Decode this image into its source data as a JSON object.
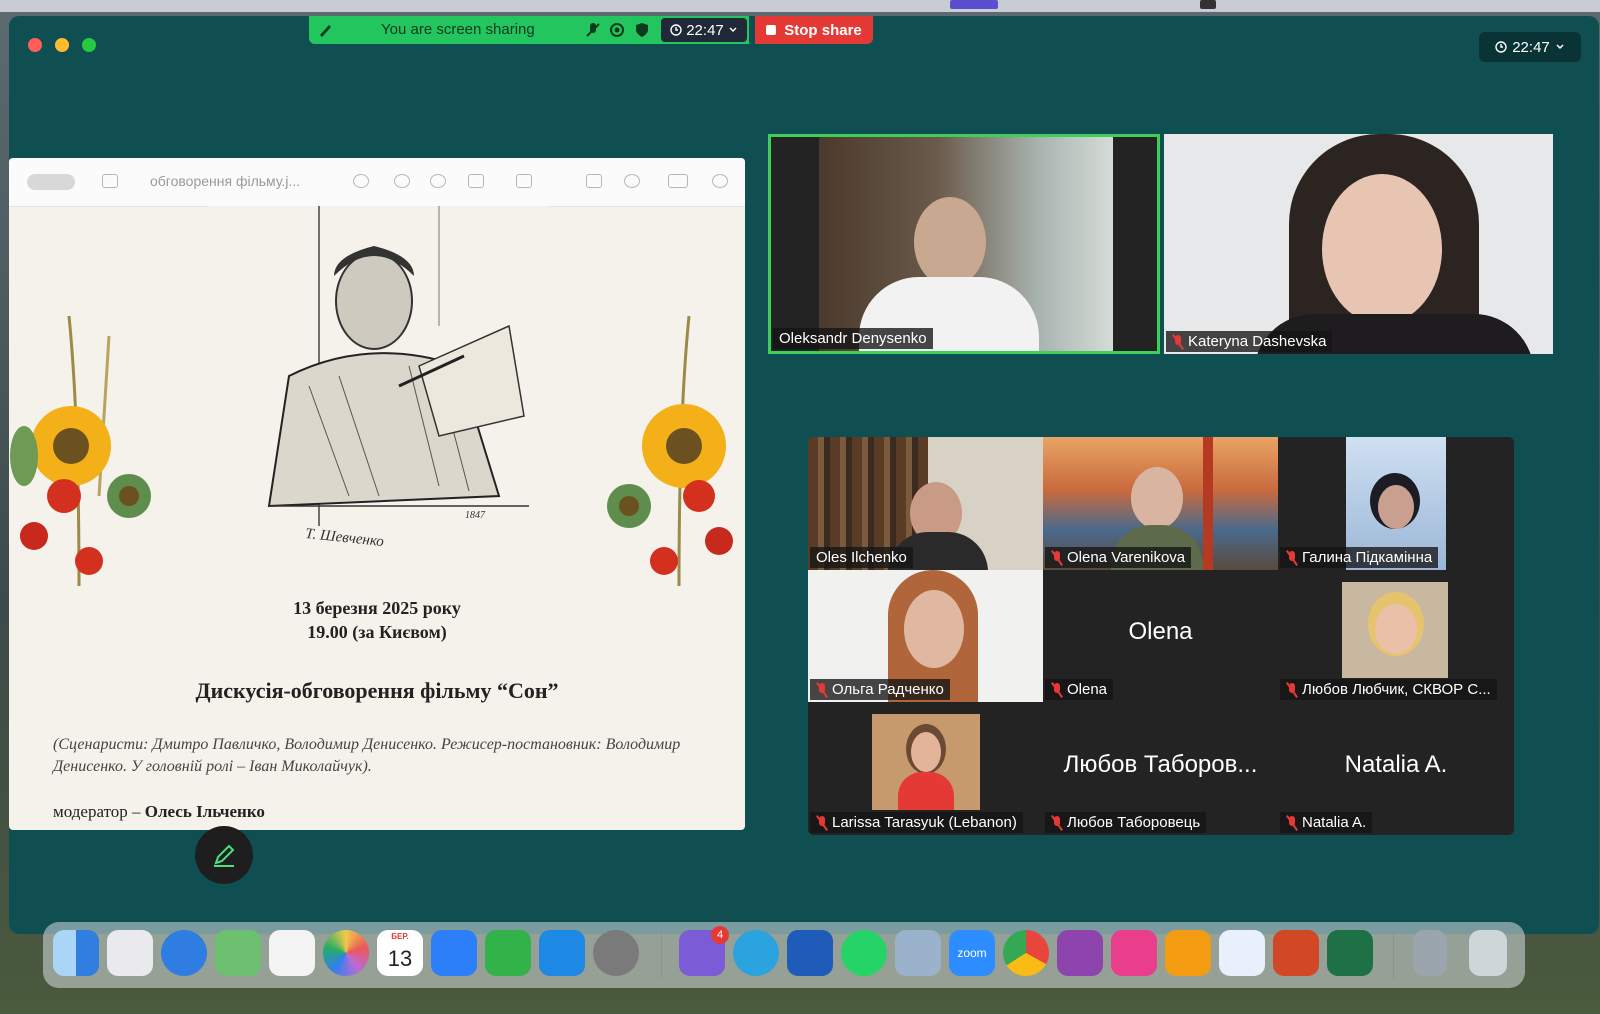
{
  "share_bar": {
    "status": "You are screen sharing",
    "time": "22:47",
    "stop_label": "Stop share",
    "color": "#22c55e"
  },
  "window": {
    "clock": "22:47",
    "bg": "#0f4f52"
  },
  "document": {
    "filename": "обговорення фільму.j...",
    "signature": "Т. Шевченко",
    "year": "1847",
    "date_line1": "13 березня 2025 року",
    "date_line2": "19.00 (за Києвом)",
    "heading": "Дискусія-обговорення фільму “Сон”",
    "credits": "(Сценаристи: Дмитро Павличко, Володимир Денисенко. Режисер-постановник: Володимир Денисенко. У головній ролі – Іван Миколайчук).",
    "moderator_label": "модератор –",
    "moderator_name": "Олесь Ільченко"
  },
  "speakers": [
    {
      "name": "Oleksandr Denysenko",
      "muted": false,
      "active": true
    },
    {
      "name": "Kateryna Dashevska",
      "muted": true,
      "active": false
    }
  ],
  "gallery": [
    {
      "name": "Oles Ilchenko",
      "muted": false,
      "video": true
    },
    {
      "name": "Olena Varenikova",
      "muted": true,
      "video": true
    },
    {
      "name": "Галина Підкамінна",
      "muted": true,
      "video": true
    },
    {
      "name": "Ольга Радченко",
      "muted": true,
      "video": true
    },
    {
      "name": "Olena",
      "muted": true,
      "video": false,
      "display": "Olena"
    },
    {
      "name": "Любов Любчик, СКВОР С...",
      "muted": true,
      "video": true
    },
    {
      "name": "Larissa Tarasyuk (Lebanon)",
      "muted": true,
      "video": true
    },
    {
      "name": "Любов Таборовець",
      "muted": true,
      "video": false,
      "display": "Любов Таборов..."
    },
    {
      "name": "Natalia A.",
      "muted": true,
      "video": false,
      "display": "Natalia A."
    }
  ],
  "dock": {
    "apps": [
      {
        "icon": "finder-icon",
        "color": "#3a8ee6"
      },
      {
        "icon": "launchpad-icon",
        "color": "#e9e9ee"
      },
      {
        "icon": "safari-icon",
        "color": "#2f7de1"
      },
      {
        "icon": "maps-icon",
        "color": "#6cc06f"
      },
      {
        "icon": "freeform-icon",
        "color": "#f4f4f4"
      },
      {
        "icon": "photos-icon",
        "color": "#f2c94c"
      },
      {
        "icon": "calendar-icon",
        "color": "#ffffff"
      },
      {
        "icon": "keynote-icon",
        "color": "#2d7ff9"
      },
      {
        "icon": "numbers-icon",
        "color": "#31b34a"
      },
      {
        "icon": "app-store-icon",
        "color": "#1e88e5"
      },
      {
        "icon": "system-settings-icon",
        "color": "#7a7a7a"
      },
      {
        "icon": "viber-icon",
        "color": "#7b5cd6"
      },
      {
        "icon": "telegram-icon",
        "color": "#2aa3df"
      },
      {
        "icon": "word-icon",
        "color": "#1f5bb8"
      },
      {
        "icon": "whatsapp-icon",
        "color": "#25d366"
      },
      {
        "icon": "preview-icon",
        "color": "#9ab2cc"
      },
      {
        "icon": "zoom-icon",
        "color": "#2d8cff"
      },
      {
        "icon": "chrome-icon",
        "color": "#e8453c"
      },
      {
        "icon": "djvu-icon",
        "color": "#8e44ad"
      },
      {
        "icon": "kanji-icon",
        "color": "#e83e8c"
      },
      {
        "icon": "books-icon",
        "color": "#f39c12"
      },
      {
        "icon": "sync-icon",
        "color": "#e8f1fb"
      },
      {
        "icon": "powerpoint-icon",
        "color": "#d24726"
      },
      {
        "icon": "excel-icon",
        "color": "#1e7145"
      },
      {
        "icon": "downloads-stack-icon",
        "color": "#9aa5ad"
      },
      {
        "icon": "trash-icon",
        "color": "#cfd6da"
      }
    ],
    "calendar_month": "БЕР.",
    "calendar_day": "13",
    "viber_badge": "4",
    "zoom_label": "zoom"
  }
}
